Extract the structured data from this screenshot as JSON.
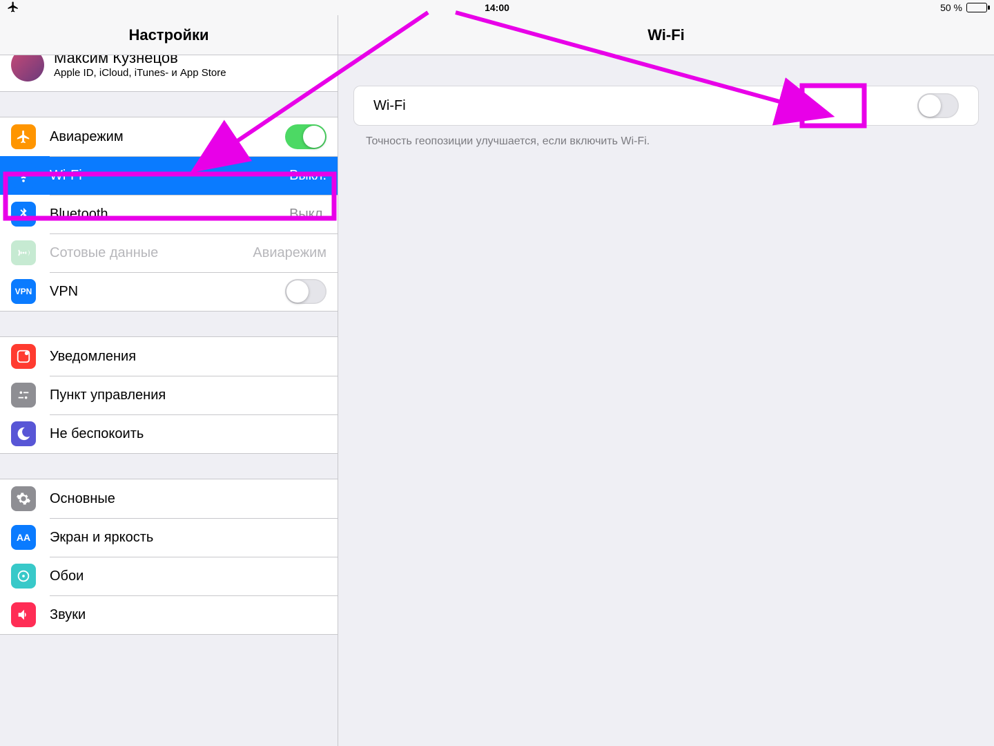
{
  "statusbar": {
    "time": "14:00",
    "battery_text": "50 %"
  },
  "left": {
    "title": "Настройки",
    "account": {
      "name": "Максим Кузнецов",
      "subtitle": "Apple ID, iCloud, iTunes- и App Store"
    },
    "group1": {
      "airplane": "Авиарежим",
      "wifi": "Wi-Fi",
      "wifi_detail": "Выкл.",
      "bluetooth": "Bluetooth",
      "bluetooth_detail": "Выкл.",
      "cellular": "Сотовые данные",
      "cellular_detail": "Авиарежим",
      "vpn": "VPN"
    },
    "group2": {
      "notifications": "Уведомления",
      "controlcenter": "Пункт управления",
      "dnd": "Не беспокоить"
    },
    "group3": {
      "general": "Основные",
      "display": "Экран и яркость",
      "wallpaper": "Обои",
      "sounds": "Звуки"
    }
  },
  "right": {
    "title": "Wi-Fi",
    "row_label": "Wi-Fi",
    "hint": "Точность геопозиции улучшается, если включить Wi-Fi."
  }
}
